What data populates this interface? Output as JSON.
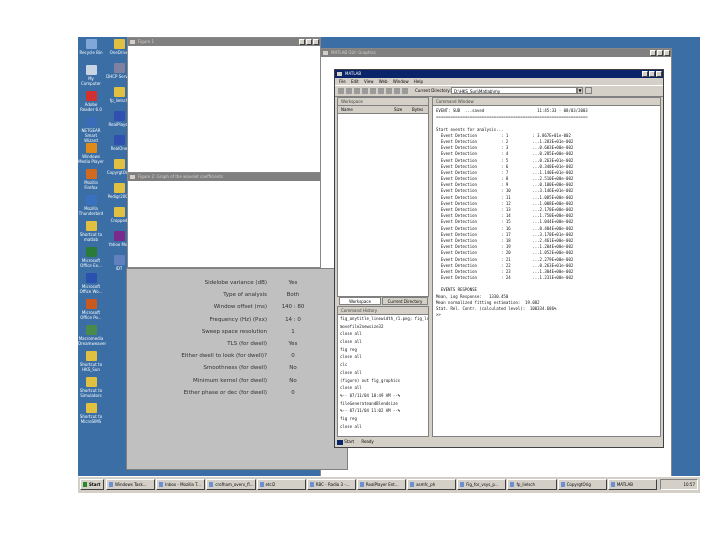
{
  "desktop": {
    "icons": [
      {
        "label": "Recycle Bin",
        "color": "#7fa7d8"
      },
      {
        "label": "My Computer",
        "color": "#c9d5e4"
      },
      {
        "label": "Adobe Reader 6.0",
        "color": "#d33030"
      },
      {
        "label": "NETGEAR Smart Wizard",
        "color": "#3a6bb8"
      },
      {
        "label": "Windows Media Player",
        "color": "#e08a1a"
      },
      {
        "label": "Mozilla Firefox",
        "color": "#d06a20"
      },
      {
        "label": "Mozilla Thunderbird",
        "color": "#3a70c0"
      },
      {
        "label": "Shortcut to matlab",
        "color": "#e0c040"
      },
      {
        "label": "Microsoft Office Ex...",
        "color": "#2a7a3a"
      },
      {
        "label": "Microsoft Office Wo...",
        "color": "#2a50b0"
      },
      {
        "label": "Microsoft Office Po...",
        "color": "#c85a20"
      },
      {
        "label": "Macromedia Dreamweaver",
        "color": "#4a8a4a"
      },
      {
        "label": "Shortcut to HKS_Sun",
        "color": "#e0c040"
      },
      {
        "label": "Shortcut to Simulators",
        "color": "#e0c040"
      },
      {
        "label": "Shortcut to MicroSIMS",
        "color": "#e0c040"
      }
    ],
    "icons2": [
      {
        "label": "OneDrive",
        "color": "#e0c040"
      },
      {
        "label": "DHCP Server",
        "color": "#8080a0"
      },
      {
        "label": "fp_lielsch",
        "color": "#e0c040"
      },
      {
        "label": "RealPlayer",
        "color": "#3050b0"
      },
      {
        "label": "RealOne",
        "color": "#3050b0"
      },
      {
        "label": "CopyrgtOrig",
        "color": "#e0c040"
      },
      {
        "label": "Pedigr2003",
        "color": "#e0c040"
      },
      {
        "label": "Cropped",
        "color": "#e0c040"
      },
      {
        "label": "Yahoo Msg",
        "color": "#7a2a8a"
      },
      {
        "label": "IDT",
        "color": "#6080c0"
      }
    ]
  },
  "fig1": {
    "title": "Figure 1"
  },
  "fig2": {
    "title": "Figure 2: Graph of the wavelet coefficients"
  },
  "fig3": {
    "title": "MATLAB GUI: Graphics"
  },
  "settings": {
    "rows": [
      {
        "label": "Sidelobe variance (dB)",
        "value": "Yes"
      },
      {
        "label": "Type of analysis",
        "value": "Both"
      },
      {
        "label": "Window offset (ms)",
        "value": "140 : 80"
      },
      {
        "label": "Frequency (Hz) (Pxx)",
        "value": "14 : 0"
      },
      {
        "label": "Sweep space resolution",
        "value": "1"
      },
      {
        "label": "TLS (for dwell)",
        "value": "Yes"
      },
      {
        "label": "Either dwell to look (for dwell)?",
        "value": "0"
      },
      {
        "label": "Smoothness (for dwell)",
        "value": "No"
      },
      {
        "label": "Minimum kernel (for dwell)",
        "value": "No"
      },
      {
        "label": "Either phase or dec (for dwell)",
        "value": "0"
      }
    ]
  },
  "matlab": {
    "title": "MATLAB",
    "menus": [
      "File",
      "Edit",
      "View",
      "Web",
      "Window",
      "Help"
    ],
    "current_directory_label": "Current Directory:",
    "current_directory_value": "D:\\HKS_Sun\\Matlab\\my",
    "workspace": {
      "title": "Workspace",
      "col_name": "Name",
      "col_size": "Size",
      "col_bytes": "Bytes"
    },
    "tabs": {
      "workspace": "Workspace",
      "current_directory": "Current Directory"
    },
    "history": {
      "title": "Command History",
      "lines": [
        "fig_anytitle_linewidth_r1.png; fig_ld...",
        "movefile2newsize32",
        "close all",
        "close all",
        "fig reg",
        "close all",
        "clc",
        "close all",
        "(figure) out fig_graphics",
        "close all",
        "%-- 07/11/04 10:49 AM --%",
        "fileGenerateandBlendsize",
        "%-- 07/11/04 11:02 AM --%",
        "fig reg",
        "close all"
      ]
    },
    "command": {
      "title": "Command Window",
      "lines": [
        "EVENT: SUB  ...saved                      11:45:33 - 08/03/2003",
        "===============================================================",
        "",
        "Start events for analysis...",
        "  Event Detection          : 1          : 3.867E+01e-002",
        "  Event Detection          : 2          ...1.283E+01e-002",
        "  Event Detection          : 3          ...0.603E+00e-002",
        "  Event Detection          : 4          ...0.285E+00e-002",
        "  Event Detection          : 5          ...0.263E+01e-002",
        "  Event Detection          : 6          ...0.340E+01e-002",
        "  Event Detection          : 7          ...1.140E+01e-002",
        "  Event Detection          : 8          ...2.510E+00e-002",
        "  Event Detection          : 9          ...0.100E+00e-002",
        "  Event Detection          : 10         ...3.146E+01e-002",
        "  Event Detection          : 11         ...1.085E+00e-002",
        "  Event Detection          : 12         ...1.008E+00e-002",
        "  Event Detection          : 13         ...2.170E+00e-002",
        "  Event Detection          : 14         ...1.750E+00e-002",
        "  Event Detection          : 15         ...1.044E+00e-002",
        "  Event Detection          : 16         ...0.404E+00e-002",
        "  Event Detection          : 17         ...3.170E+01e-002",
        "  Event Detection          : 18         ...2.461E+00e-002",
        "  Event Detection          : 19         ...1.204E+00e-002",
        "  Event Detection          : 20         ...1.052E+00e-002",
        "  Event Detection          : 21         ...2.279E+00e-002",
        "  Event Detection          : 22         ...0.263E+01e-002",
        "  Event Detection          : 23         ...1.304E+00e-002",
        "  Event Detection          : 24         ...1.231E+00e-002",
        "",
        "  EVENTS RESPONSE",
        "Mean, Log Response:   1330.450",
        "Mean normalized fitting estimation:  19.082",
        "Stat. Rel. Contr. (calculated level):  100334.686%",
        ">>"
      ]
    },
    "start_label": "Start",
    "status_text": "Ready"
  },
  "taskbar": {
    "start": "Start",
    "buttons": [
      "Windows Task...",
      "Inbox - Mozilla T...",
      "crofham_overv_fl...",
      "etcl2",
      "RBC - Radio 3 -...",
      "RealPlayer Ent...",
      "asmfc_ph",
      "Fig_for_vsys_p...",
      "fp_lielsch",
      "CopyrgtOrig",
      "MATLAB"
    ],
    "clock": "10:57"
  }
}
